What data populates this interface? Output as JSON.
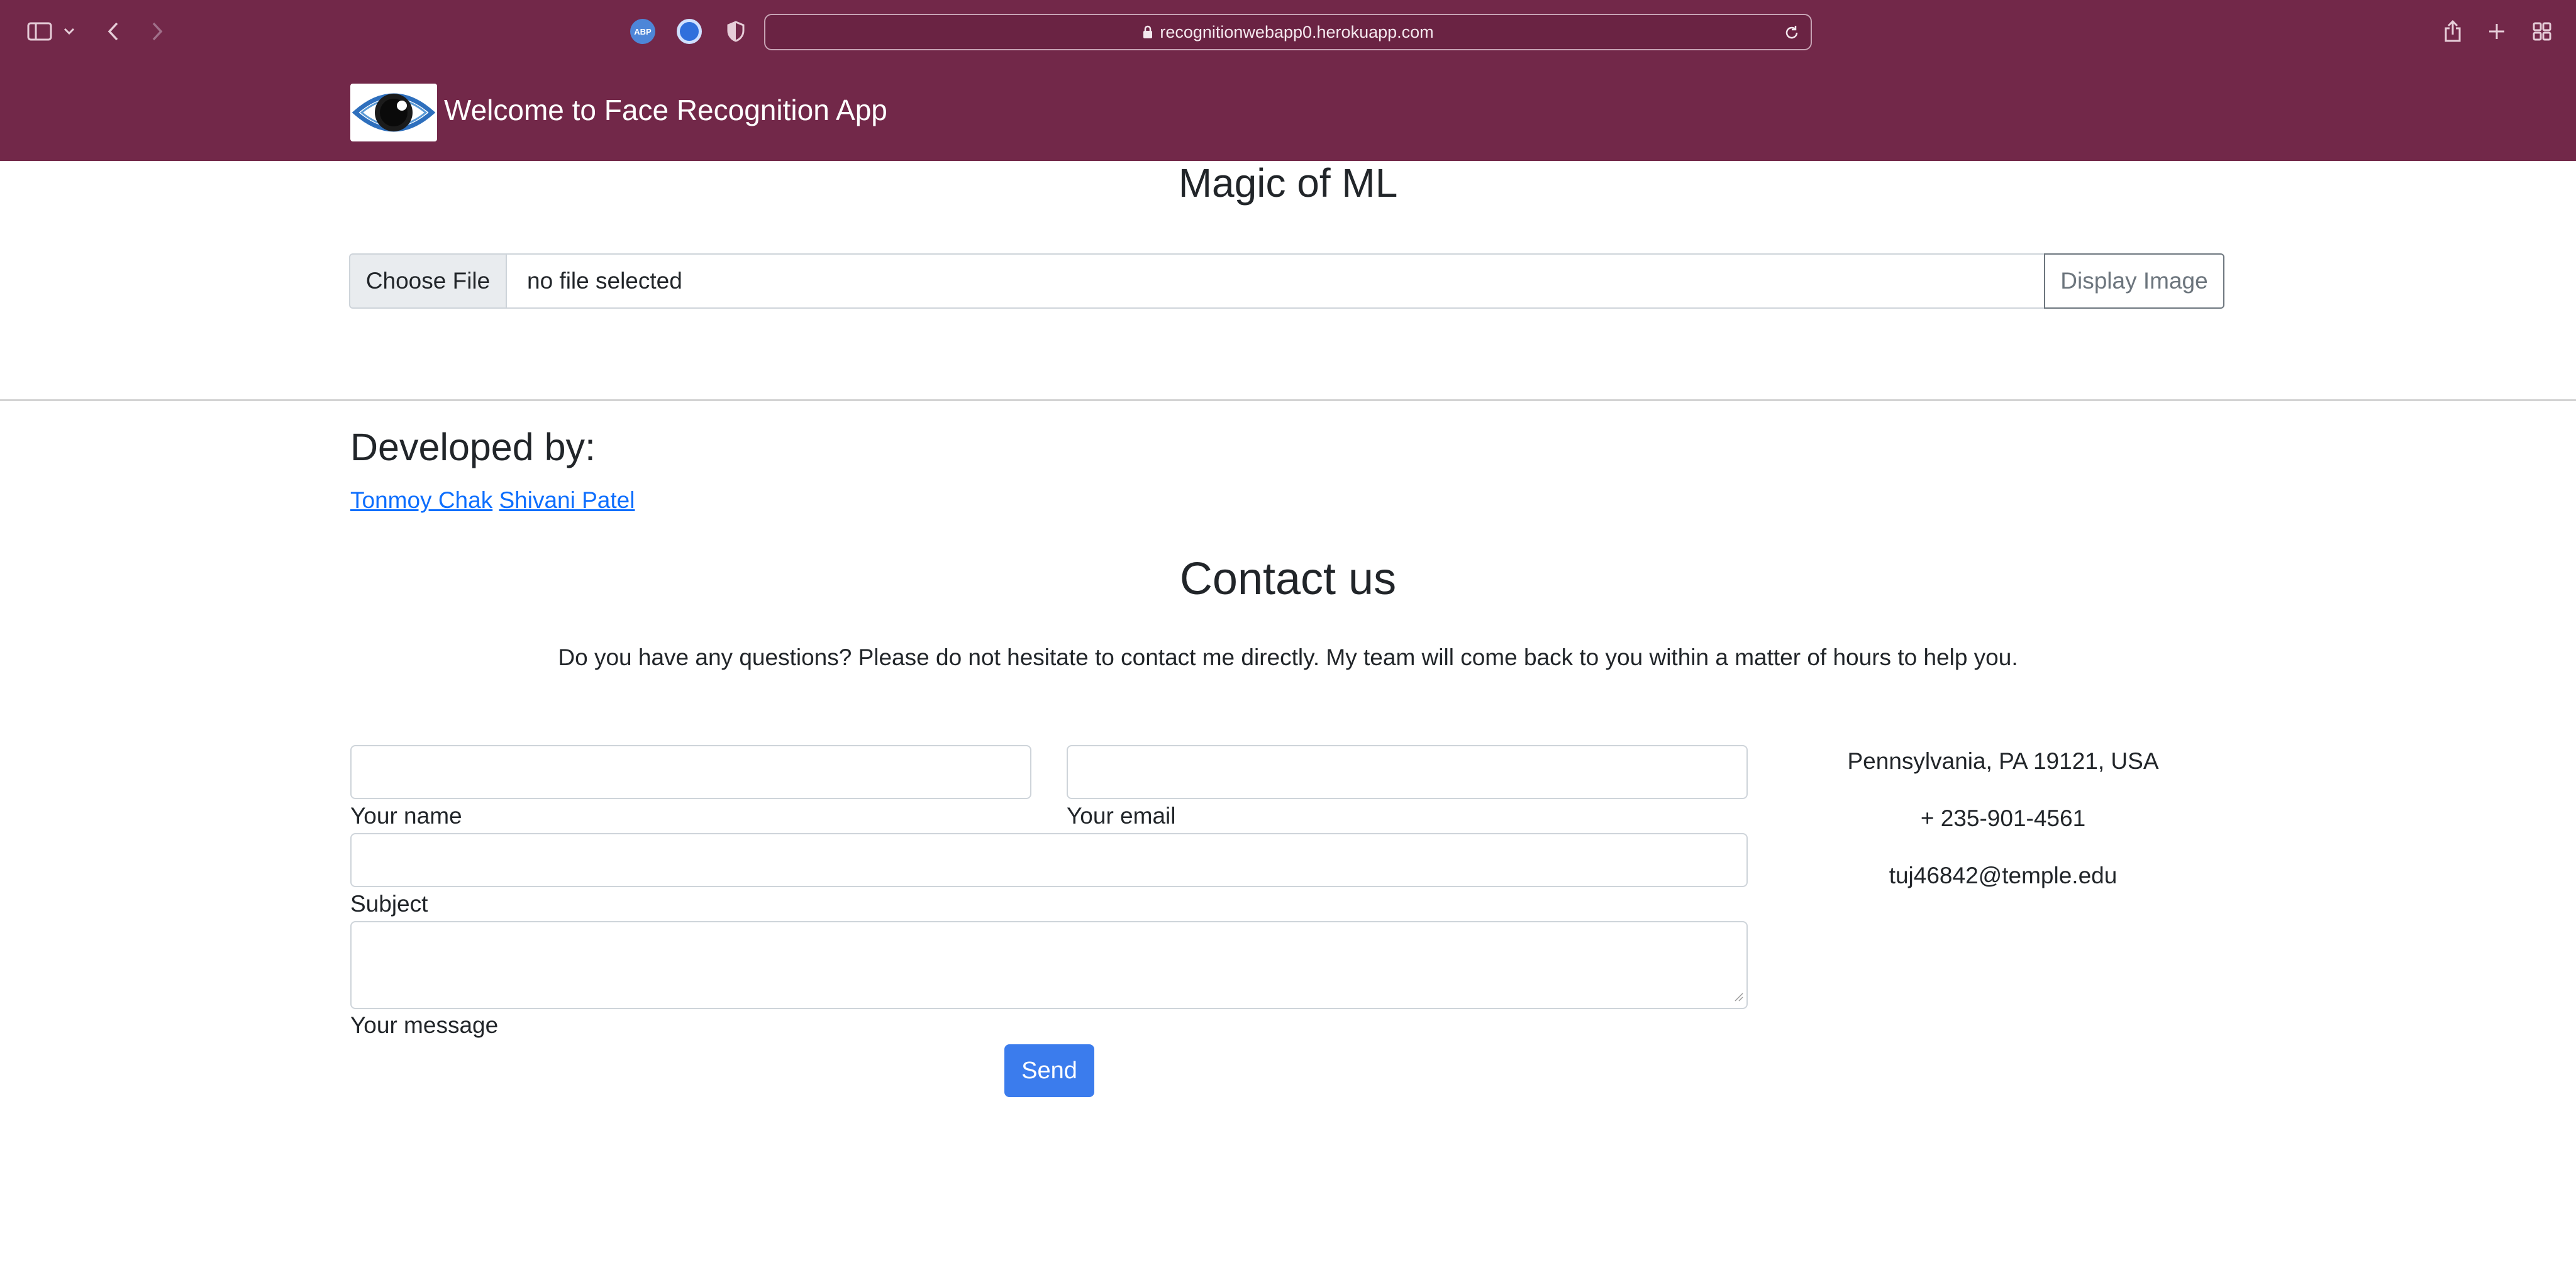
{
  "browser": {
    "url": "recognitionwebapp0.herokuapp.com",
    "extension_abp_label": "ABP"
  },
  "navbar": {
    "brand_title": "Welcome to Face Recognition App"
  },
  "upload": {
    "heading": "Magic of ML",
    "choose_file_label": "Choose File",
    "file_status": "no file selected",
    "display_button_label": "Display Image"
  },
  "developers": {
    "heading": "Developed by:",
    "names": [
      "Tonmoy Chak",
      "Shivani Patel"
    ]
  },
  "contact": {
    "heading": "Contact us",
    "subtitle": "Do you have any questions? Please do not hesitate to contact me directly. My team will come back to you within a matter of hours to help you.",
    "fields": {
      "name_label": "Your name",
      "email_label": "Your email",
      "subject_label": "Subject",
      "message_label": "Your message"
    },
    "send_label": "Send",
    "info": {
      "address": "Pennsylvania, PA 19121, USA",
      "phone": "+ 235-901-4561",
      "email": "tuj46842@temple.edu"
    }
  },
  "colors": {
    "brand": "#722849",
    "link": "#0d6efd",
    "send_button": "#3b7ced"
  }
}
